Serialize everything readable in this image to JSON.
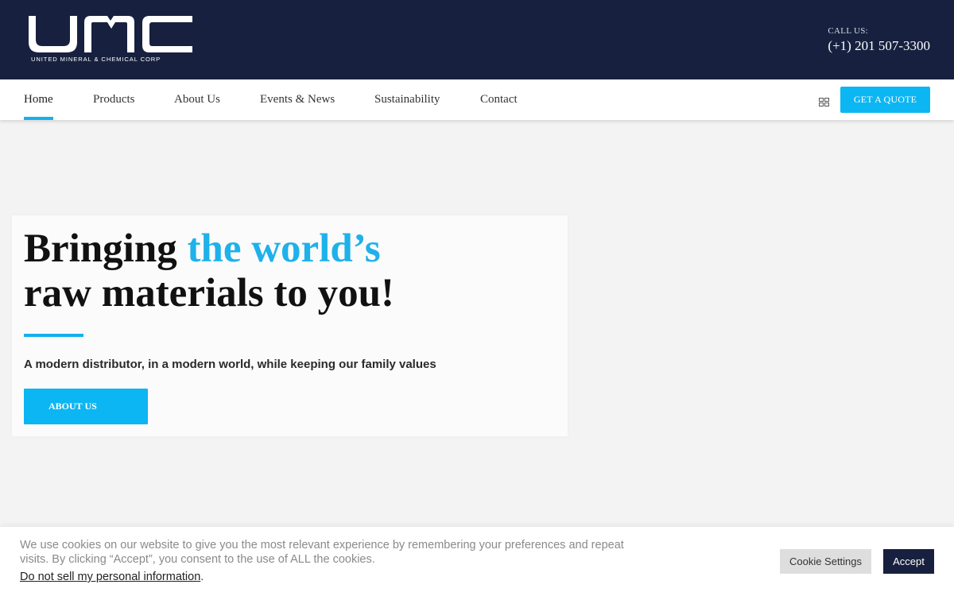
{
  "header": {
    "logo_text": "UMC",
    "logo_subtitle": "UNITED MINERAL & CHEMICAL CORP",
    "call_label": "CALL US:",
    "phone": "(+1) 201 507-3300",
    "bg_color": "#17213f"
  },
  "nav": {
    "items": [
      {
        "label": "Home",
        "active": true
      },
      {
        "label": "Products",
        "active": false
      },
      {
        "label": "About Us",
        "active": false
      },
      {
        "label": "Events & News",
        "active": false
      },
      {
        "label": "Sustainability",
        "active": false
      },
      {
        "label": "Contact",
        "active": false
      }
    ],
    "grid_icon": "grid-icon",
    "quote_button": "GET A QUOTE",
    "accent_color": "#0cb6f2"
  },
  "hero": {
    "title_part1": "Bringing ",
    "title_accent": "the world’s",
    "title_line2": "raw materials to you!",
    "subtitle": "A modern distributor, in a modern world, while keeping our family values",
    "button": "ABOUT US"
  },
  "cookie": {
    "text": "We use cookies on our website to give you the most relevant experience by remembering your preferences and repeat visits. By clicking “Accept”, you consent to the use of ALL the cookies.",
    "link": "Do not sell my personal information",
    "link_suffix": ".",
    "settings_button": "Cookie Settings",
    "accept_button": "Accept"
  }
}
